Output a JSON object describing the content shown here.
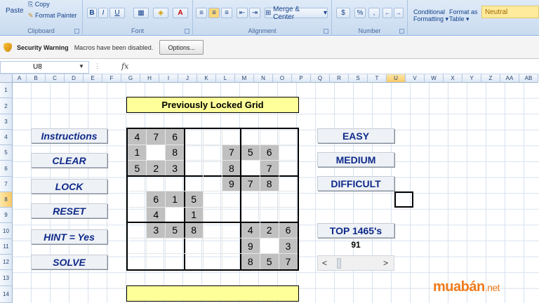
{
  "ribbon": {
    "clipboard": {
      "label": "Clipboard",
      "paste": "Paste",
      "copy": "Copy",
      "format_painter": "Format Painter"
    },
    "font": {
      "label": "Font",
      "bold": "B",
      "italic": "I",
      "underline": "U",
      "font_color_glyph": "A"
    },
    "alignment": {
      "label": "Alignment",
      "merge_center": "Merge & Center"
    },
    "number": {
      "label": "Number",
      "currency": "$",
      "percent": "%",
      "comma": ","
    },
    "styles": {
      "conditional_formatting": "Conditional",
      "conditional_formatting_2": "Formatting",
      "format_as_table": "Format as",
      "format_as_table_2": "Table",
      "neutral": "Neutral"
    }
  },
  "security_warning": {
    "title": "Security Warning",
    "message": "Macros have been disabled.",
    "options_button": "Options..."
  },
  "formula_bar": {
    "name_box": "U8",
    "fx": "fx"
  },
  "columns": [
    "A",
    "B",
    "C",
    "D",
    "E",
    "F",
    "G",
    "H",
    "I",
    "J",
    "K",
    "L",
    "M",
    "N",
    "O",
    "P",
    "Q",
    "R",
    "S",
    "T",
    "U",
    "V",
    "W",
    "X",
    "Y",
    "Z",
    "AA",
    "AB"
  ],
  "selected_column": "U",
  "rows": [
    "1",
    "2",
    "3",
    "4",
    "5",
    "6",
    "7",
    "8",
    "9",
    "10",
    "11",
    "12",
    "13",
    "14"
  ],
  "selected_row": "8",
  "sheet": {
    "title": "Previously Locked Grid",
    "left_buttons": [
      "Instructions",
      "CLEAR",
      "LOCK",
      "RESET",
      "HINT = Yes",
      "SOLVE"
    ],
    "right_buttons": [
      "EASY",
      "MEDIUM",
      "DIFFICULT",
      "TOP 1465's"
    ],
    "top_count": "91",
    "scroll_left": "<",
    "scroll_right": ">"
  },
  "sudoku": [
    [
      "4",
      "7",
      "6",
      "",
      "",
      "",
      "",
      "",
      ""
    ],
    [
      "1",
      "",
      "8",
      "",
      "",
      "7",
      "5",
      "6",
      ""
    ],
    [
      "5",
      "2",
      "3",
      "",
      "",
      "8",
      "",
      "7",
      ""
    ],
    [
      "",
      "",
      "",
      "",
      "",
      "9",
      "7",
      "8",
      ""
    ],
    [
      "",
      "6",
      "1",
      "5",
      "",
      "",
      "",
      "",
      ""
    ],
    [
      "",
      "4",
      "",
      "1",
      "",
      "",
      "",
      "",
      ""
    ],
    [
      "",
      "3",
      "5",
      "8",
      "",
      "",
      "4",
      "2",
      "6"
    ],
    [
      "",
      "",
      "",
      "",
      "",
      "",
      "9",
      "",
      "3"
    ],
    [
      "",
      "",
      "",
      "",
      "",
      "",
      "8",
      "5",
      "7"
    ]
  ],
  "sudoku_filled": [
    [
      1,
      1,
      1,
      0,
      0,
      0,
      0,
      0,
      0
    ],
    [
      1,
      2,
      1,
      0,
      0,
      1,
      1,
      1,
      0
    ],
    [
      1,
      1,
      1,
      0,
      0,
      1,
      2,
      1,
      0
    ],
    [
      0,
      0,
      0,
      0,
      0,
      1,
      1,
      1,
      0
    ],
    [
      0,
      1,
      1,
      1,
      0,
      0,
      0,
      0,
      0
    ],
    [
      0,
      1,
      2,
      1,
      0,
      0,
      0,
      0,
      0
    ],
    [
      0,
      1,
      1,
      1,
      0,
      0,
      1,
      1,
      1
    ],
    [
      0,
      0,
      0,
      0,
      0,
      0,
      1,
      2,
      1
    ],
    [
      0,
      0,
      0,
      0,
      0,
      0,
      1,
      1,
      1
    ]
  ],
  "watermark": {
    "main": "muabán",
    "suffix": ".net"
  },
  "colors": {
    "neutral_bg": "#ffeb9c",
    "button_text": "#0e2a8a",
    "grid_given": "#c0c0c0",
    "title_bg": "#ffff99"
  }
}
